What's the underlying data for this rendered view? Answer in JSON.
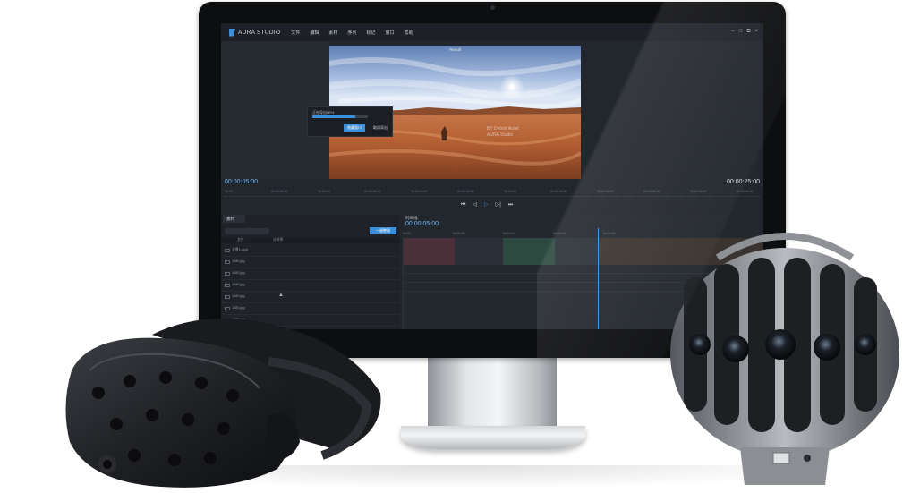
{
  "app": {
    "title": "AURA STUDIO",
    "menu": [
      "文件",
      "编辑",
      "素材",
      "序列",
      "标记",
      "窗口",
      "帮助"
    ],
    "window_controls": [
      "–",
      "□",
      "⧉",
      "×"
    ],
    "accent_color": "#3d8fd9"
  },
  "preview": {
    "title": "Result",
    "watermark_line1": "BY Detroit Auret",
    "watermark_line2": "AURA Studio"
  },
  "dialog": {
    "label": "正在导出MP4",
    "progress": 0.78,
    "ok_label": "隐藏窗口",
    "cancel_label": "取消导出"
  },
  "player": {
    "current_time": "00:00:05:00",
    "total_time": "00:00:25:00",
    "ruler_labels": [
      "00:00",
      "00:00:05:00",
      "00:00:10",
      "00:00:05:00",
      "00:00:10:00",
      "00:00:15:00",
      "00:00:20",
      "00:00:25:00",
      "00:00:30:00",
      "00:00:35:00",
      "00:00:40:00",
      "00:00:45:00"
    ],
    "transport_icons": [
      "skip-back-icon",
      "step-back-icon",
      "play-icon",
      "step-forward-icon",
      "skip-forward-icon"
    ],
    "transport_glyphs": [
      "⏮",
      "◁",
      "▷",
      "▷|",
      "⏭"
    ]
  },
  "assets": {
    "tab": "素材",
    "import_button": "一键整理",
    "col_name": "文件",
    "col_info": "分辨率",
    "rows": [
      "全景1.mp4",
      "1080.jpg",
      "1080.jpg",
      "1080.jpg",
      "1080.jpg",
      "1080.jpg",
      "1080.jpg"
    ]
  },
  "timeline": {
    "tab": "时间线",
    "current_time": "00:00:05:00",
    "ruler_labels": [
      "00:00",
      "00:00:05",
      "00:00:10",
      "00:00:15",
      "00:00:20"
    ]
  },
  "devices": {
    "headset": "vr-headset",
    "camera": "360-camera"
  }
}
